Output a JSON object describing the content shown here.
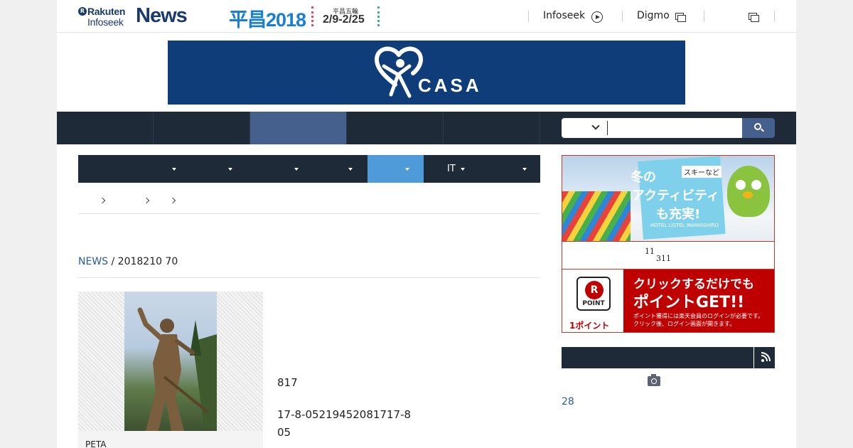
{
  "header": {
    "logo": {
      "line1": "Rakuten",
      "line2": "Infoseek",
      "news": "News",
      "r_mark": "R"
    },
    "event": {
      "title": "平昌2018",
      "subtitle": "平昌五輪",
      "dates": "2/9-2/25"
    },
    "links": [
      {
        "label": "Infoseek",
        "icon": "circle-arrow-icon"
      },
      {
        "label": "Digmo",
        "icon": "new-window-icon"
      },
      {
        "label": "",
        "icon": "new-window-icon"
      }
    ]
  },
  "banner": {
    "brand": "CASA",
    "bg": "#0e3d7a"
  },
  "global_nav": {
    "tabs": [
      "",
      "",
      "",
      "",
      ""
    ],
    "active_index": 2
  },
  "search": {
    "placeholder": "",
    "value": ""
  },
  "category_nav": {
    "items": [
      "",
      "",
      "",
      "",
      "",
      "IT",
      ""
    ],
    "active_index": 4
  },
  "breadcrumb": [
    "",
    "",
    "",
    ""
  ],
  "article": {
    "source": "NEWS",
    "meta": " / 2018210 70",
    "caption": "PETA",
    "paragraphs": [
      "817",
      "17-8-05219452081717-8",
      "05"
    ]
  },
  "sidebar": {
    "ad1": {
      "line1": "冬の",
      "tag": "スキーなど",
      "line2": "アクティビティ",
      "line3": "も充実!",
      "hotel": "HOTEL LISTEL INAWASHIRO"
    },
    "point_notice": {
      "a": "11",
      "b": "311"
    },
    "ad2": {
      "badge_letter": "R",
      "badge_label": "POINT",
      "one_point": "1ポイント",
      "headline1": "クリックするだけでも",
      "headline2": "ポイントGET!!",
      "fine1": "ポイント獲得には楽天会員のログインが必要です。",
      "fine2": "クリック後、ログイン画面が開きます。"
    },
    "ranking": {
      "title": "",
      "first_value": "28"
    }
  },
  "colors": {
    "nav_dark": "#1f2a38",
    "nav_active": "#46608e",
    "category_active": "#4f9ad8",
    "brand_red": "#bf0000",
    "link_blue": "#2a5b9a"
  }
}
